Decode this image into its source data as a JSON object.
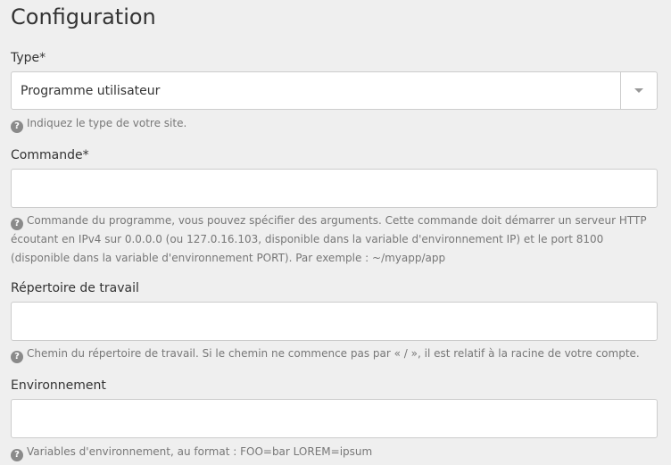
{
  "page": {
    "title": "Configuration"
  },
  "fields": {
    "type": {
      "label": "Type*",
      "value": "Programme utilisateur",
      "help": "Indiquez le type de votre site."
    },
    "commande": {
      "label": "Commande*",
      "value": "",
      "help": "Commande du programme, vous pouvez spécifier des arguments. Cette commande doit démarrer un serveur HTTP écoutant en IPv4 sur 0.0.0.0 (ou 127.0.16.103, disponible dans la variable d'environnement IP) et le port 8100 (disponible dans la variable d'environnement PORT). Par exemple : ~/myapp/app"
    },
    "repertoire": {
      "label": "Répertoire de travail",
      "value": "",
      "help": "Chemin du répertoire de travail. Si le chemin ne commence pas par « / », il est relatif à la racine de votre compte."
    },
    "environnement": {
      "label": "Environnement",
      "value": "",
      "help": "Variables d'environnement, au format : FOO=bar LOREM=ipsum"
    }
  },
  "icons": {
    "help": "question-circle-icon",
    "select_arrow": "caret-down-icon"
  },
  "colors": {
    "background": "#efefef",
    "input_border": "#cccccc",
    "help_text": "#777777",
    "help_icon": "#8a8a8a"
  }
}
